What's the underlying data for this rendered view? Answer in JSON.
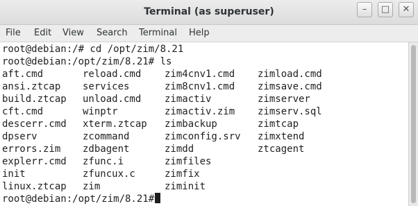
{
  "window": {
    "title": "Terminal (as superuser)",
    "controls": {
      "minimize": "–",
      "maximize": "□",
      "close": "✕"
    }
  },
  "menu": {
    "items": [
      "File",
      "Edit",
      "View",
      "Search",
      "Terminal",
      "Help"
    ]
  },
  "terminal": {
    "lines": [
      "root@debian:/# cd /opt/zim/8.21",
      "root@debian:/opt/zim/8.21# ls"
    ],
    "listing": {
      "columns": [
        [
          "aft.cmd",
          "ansi.ztcap",
          "build.ztcap",
          "cft.cmd",
          "descerr.cmd",
          "dpserv",
          "errors.zim",
          "explerr.cmd",
          "init",
          "linux.ztcap"
        ],
        [
          "reload.cmd",
          "services",
          "unload.cmd",
          "winptr",
          "xterm.ztcap",
          "zcommand",
          "zdbagent",
          "zfunc.i",
          "zfuncux.c",
          "zim"
        ],
        [
          "zim4cnv1.cmd",
          "zim8cnv1.cmd",
          "zimactiv",
          "zimactiv.zim",
          "zimbackup",
          "zimconfig.srv",
          "zimdd",
          "zimfiles",
          "zimfix",
          "ziminit"
        ],
        [
          "zimload.cmd",
          "zimsave.cmd",
          "zimserver",
          "zimserv.sql",
          "zimtcap",
          "zimxtend",
          "ztcagent"
        ]
      ]
    },
    "prompt": "root@debian:/opt/zim/8.21#"
  }
}
